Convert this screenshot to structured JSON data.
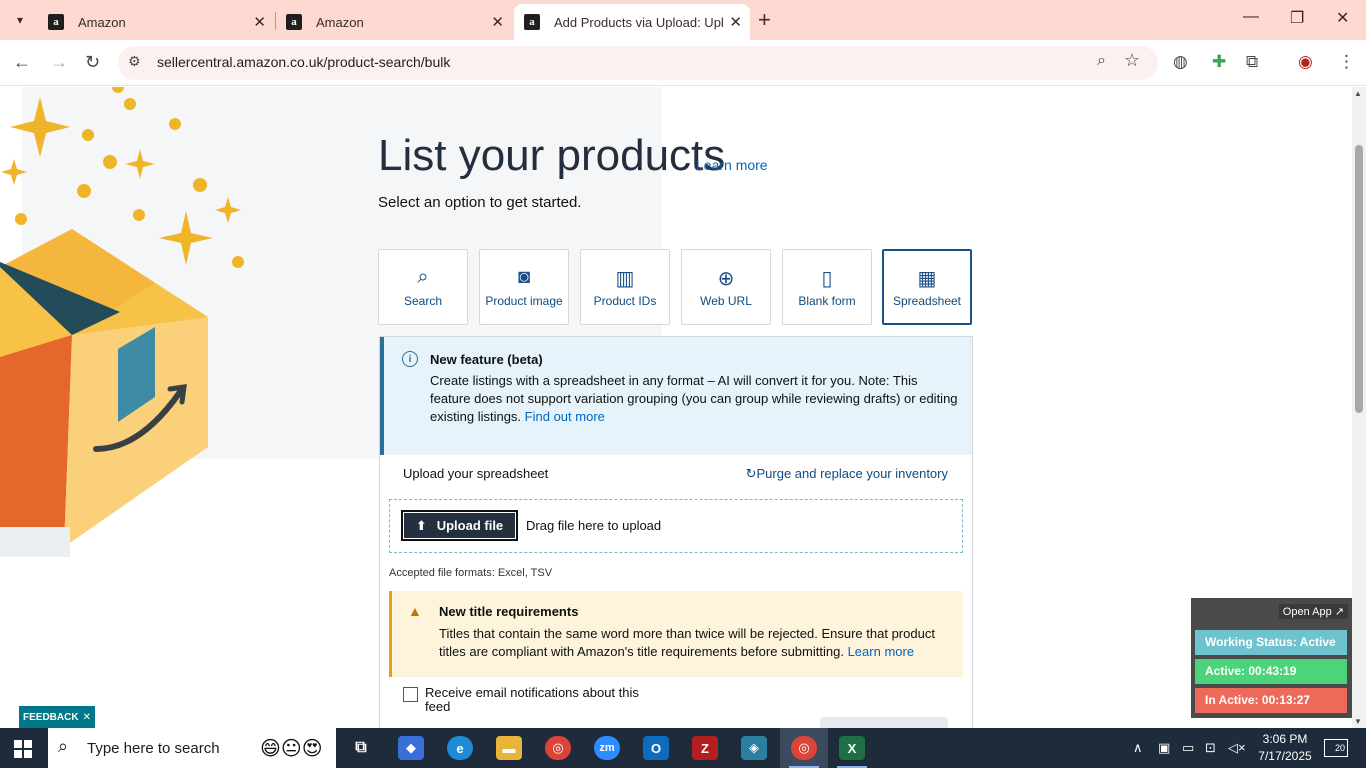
{
  "browser": {
    "tabs": [
      {
        "title": "Amazon"
      },
      {
        "title": "Amazon"
      },
      {
        "title": "Add Products via Upload: Uploa"
      }
    ],
    "url": "sellercentral.amazon.co.uk/product-search/bulk"
  },
  "page": {
    "heading": "List your products",
    "learn_more": "Learn more",
    "subtitle": "Select an option to get started.",
    "options": [
      {
        "label": "Search",
        "icon": "search-barcode-icon"
      },
      {
        "label": "Product image",
        "icon": "camera-icon"
      },
      {
        "label": "Product IDs",
        "icon": "barcode-icon"
      },
      {
        "label": "Web URL",
        "icon": "globe-icon"
      },
      {
        "label": "Blank form",
        "icon": "document-icon"
      },
      {
        "label": "Spreadsheet",
        "icon": "table-icon"
      }
    ],
    "selected_option": "Spreadsheet",
    "beta": {
      "title": "New feature (beta)",
      "description": "Create listings with a spreadsheet in any format – AI will convert it for you. Note: This feature does not support variation grouping (you can group while reviewing drafts) or editing existing listings.",
      "link": "Find out more"
    },
    "upload": {
      "title": "Upload your spreadsheet",
      "purge_link": "Purge and replace your inventory",
      "button": "Upload file",
      "drag_text": "Drag file here to upload",
      "accepted": "Accepted file formats: Excel, TSV"
    },
    "warning": {
      "title": "New title requirements",
      "description": "Titles that contain the same word more than twice will be rejected. Ensure that product titles are compliant with Amazon's title requirements before submitting.",
      "link": "Learn more"
    },
    "email_checkbox": {
      "label": "Receive email notifications about this feed",
      "checked": false
    },
    "feedback": "FEEDBACK"
  },
  "tracker": {
    "open_app": "Open App ↗",
    "status": "Working Status: Active",
    "active": "Active: 00:43:19",
    "inactive": "In Active: 00:13:27"
  },
  "taskbar": {
    "search_placeholder": "Type here to search",
    "time": "3:06 PM",
    "date": "7/17/2025",
    "notification_count": "20"
  },
  "colors": {
    "tab_bar": "#fdd9d2",
    "amazon_navy": "#232f3e",
    "link_blue": "#0066c0",
    "beta_bg": "#e6f3fa",
    "warning_bg": "#fdf4db",
    "tracker_status": "#6fc3ce",
    "tracker_active": "#4cd47b",
    "tracker_inactive": "#ed6a5a"
  }
}
